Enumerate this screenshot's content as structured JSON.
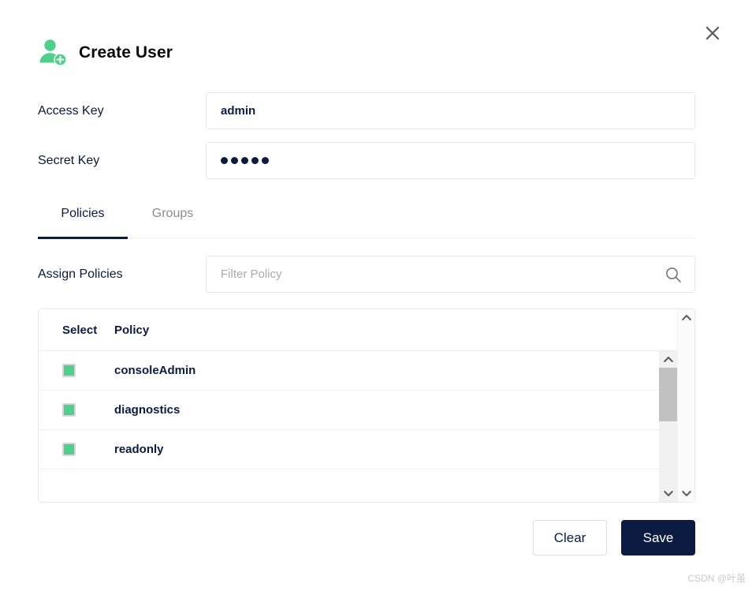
{
  "dialog": {
    "title": "Create User",
    "icon": "user-add-icon",
    "close_icon": "close-icon"
  },
  "fields": {
    "access_key": {
      "label": "Access Key",
      "value": "admin",
      "placeholder": ""
    },
    "secret_key": {
      "label": "Secret Key",
      "value": "•••••",
      "masked_char_count": 5,
      "placeholder": ""
    }
  },
  "tabs": [
    {
      "label": "Policies",
      "active": true
    },
    {
      "label": "Groups",
      "active": false
    }
  ],
  "assign": {
    "label": "Assign Policies",
    "filter_placeholder": "Filter Policy",
    "filter_value": "",
    "search_icon": "search-icon"
  },
  "table": {
    "columns": [
      "Select",
      "Policy"
    ],
    "rows": [
      {
        "selected": true,
        "policy": "consoleAdmin"
      },
      {
        "selected": true,
        "policy": "diagnostics"
      },
      {
        "selected": true,
        "policy": "readonly"
      }
    ]
  },
  "footer": {
    "clear_label": "Clear",
    "save_label": "Save"
  },
  "watermark": "CSDN @叶虽",
  "colors": {
    "accent_green": "#4ed08d",
    "navy": "#0b1b42",
    "border": "#e8e8e8",
    "muted": "#8b8b8b",
    "scrollbar_thumb": "#c1c1c1",
    "scrollbar_track": "#f1f1f1"
  }
}
